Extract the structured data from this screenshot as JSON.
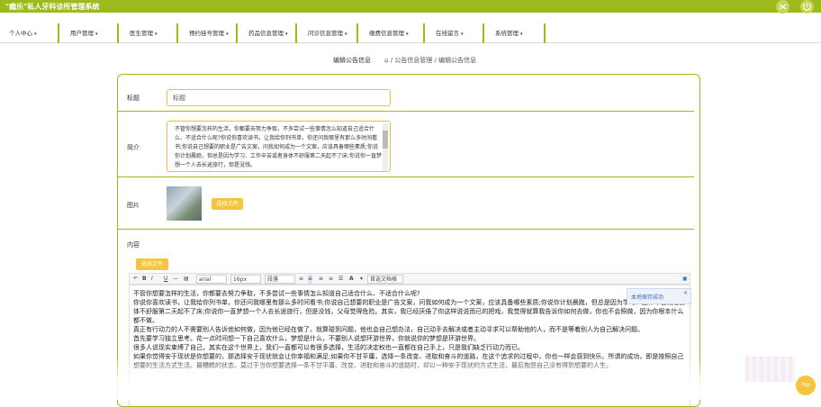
{
  "app": {
    "title": "\"瘾乐\"私人牙科诊所管理系统",
    "icon_right_1": "shuffle-icon",
    "icon_right_2": "logout-icon"
  },
  "nav": {
    "items": [
      {
        "label": "个人中心"
      },
      {
        "label": "用户管理"
      },
      {
        "label": "医生管理"
      },
      {
        "label": "预约挂号管理"
      },
      {
        "label": "药品信息管理"
      },
      {
        "label": "问诊信息管理"
      },
      {
        "label": "缴费信息管理"
      },
      {
        "label": "在线留言"
      },
      {
        "label": "系统管理"
      }
    ],
    "caret": "▾"
  },
  "page": {
    "heading": "编辑公告信息",
    "breadcrumb_home": "⌂",
    "breadcrumb": "/ 公告信息管理 / 编辑公告信息"
  },
  "form": {
    "title_label": "标题",
    "title_value": "标题",
    "intro_label": "简介",
    "intro_value": "不管你想要怎样的生活，你都要去努力争取，不多尝试一些事情怎么知道自己适合什么、不适合什么呢?你说你喜欢读书，让我给你列书单，你还问我哪里有那么多时间看书;你说自己想要的职业是广告文案，问我如何成为一个文案，应该具备哪些素质;你说你计划晨跑，但总是因为学习、工作辛苦或者身体不舒服第二天起不了床;你说你一直梦想一个人去长途旅行，但是没钱。",
    "image_label": "图片",
    "upload_image_button": "选择文件",
    "content_label": "内容",
    "upload_content_button": "选择文件",
    "toolbar": {
      "font_name": "arial",
      "font_size": "16px",
      "paragraph": "段落",
      "line_height": "首选文档格"
    },
    "toast": "本地保存成功",
    "content_paragraphs": [
      "不管你想要怎样的生活，你都要去努力争取，不多尝试一些事情怎么知道自己适合什么、不适合什么呢?",
      "你说你喜欢读书，让我给你列书单，你还问我哪里有那么多时间看书;你说自己想要的职业是广告文案，问我如何成为一个文案，应该具备哪些素质;你说你计划晨跑，但总是因为学习、工作辛苦或者身体不舒服第二天起不了床;你说你一直梦想一个人去长途旅行，但是没钱，父母觉得危险。其实，我已经厌倦了你这样说说而已的把戏，我觉得就算我告诉你如何去做，你也不会照做，因为你根本什么都不做。",
      "真正有行动力的人不需要别人告诉他如何做，因为他已经在做了。就算碰到问题，他也会自己想办法，自己动手去解决或者主动寻求可以帮助他的人，而不是等着别人为自己解决问题。",
      "首先要学习独立思考。花一点时间想一下自己喜欢什么，梦想是什么，不要别人说想环游世界，你就说你的梦想是环游世界。",
      "很多人说现实束缚了自己，其实在这个世界上，我们一直都可以有很多选择，生活的决定权也一直都在自己手上，只是我们缺乏行动力而已。",
      "如果你觉得安于现状是你想要的，那选择安于现状就会让你幸福和满足;如果你不甘平庸，选择一条改变、进取和奋斗的道路，在这个追求的过程中，你也一样会感到快乐。所谓的成功，即是按照自己想要的生活方式生活。最糟糕的状态，莫过于当你想要选择一条不甘平庸、改变、进取和奋斗的道路时，却以一种安于现状的方式生活，最后抱怨自己没有得到想要的人生。"
    ]
  },
  "floating": {
    "top_button": "Top"
  }
}
